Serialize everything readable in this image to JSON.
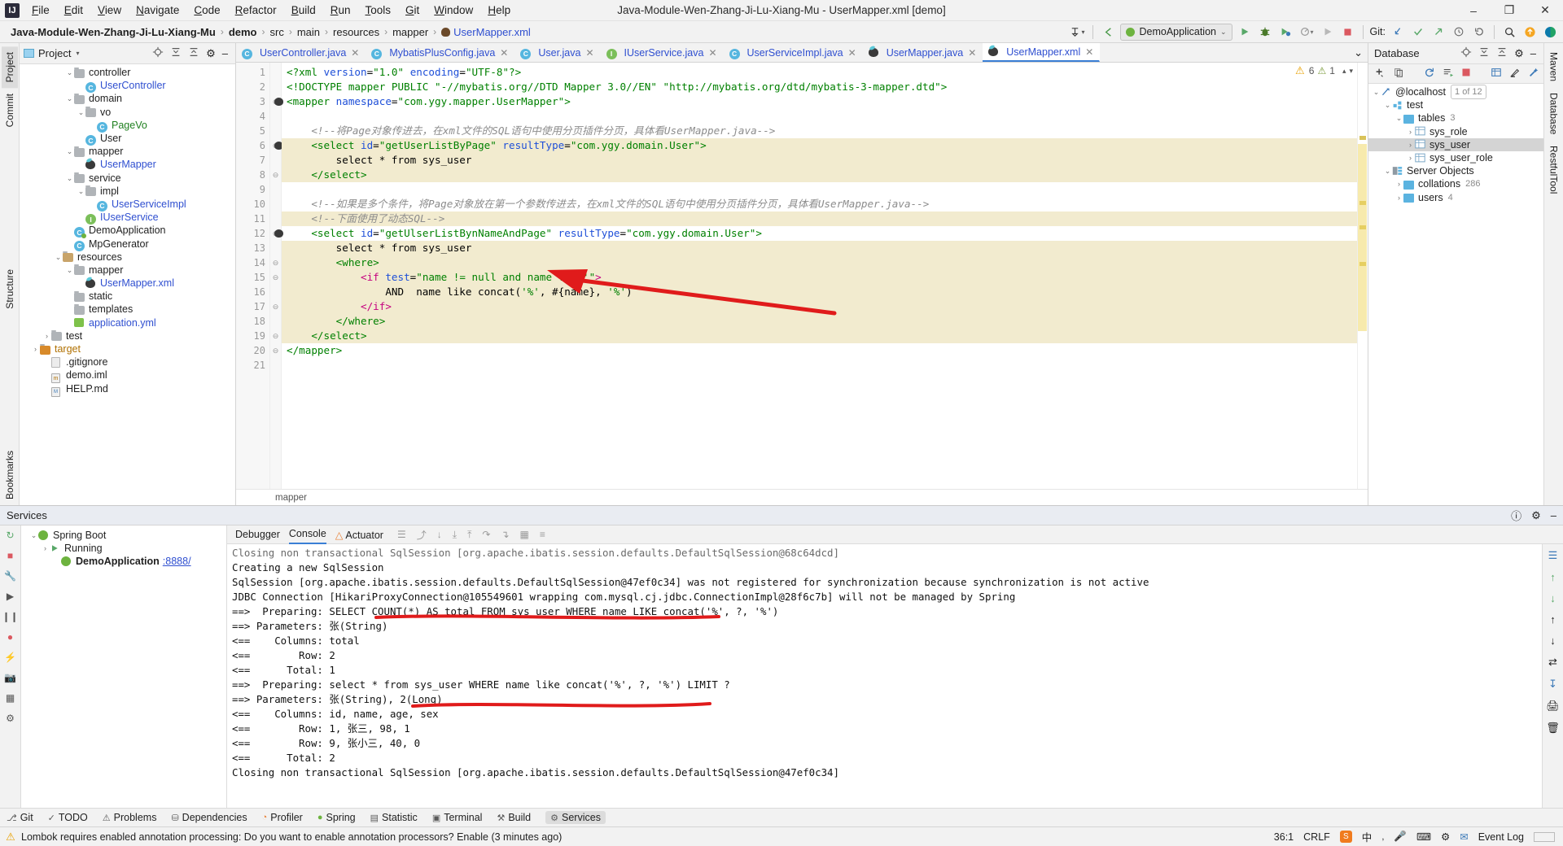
{
  "window": {
    "title": "Java-Module-Wen-Zhang-Ji-Lu-Xiang-Mu - UserMapper.xml [demo]",
    "minimize": "–",
    "maximize": "❐",
    "close": "✕"
  },
  "menu": [
    "File",
    "Edit",
    "View",
    "Navigate",
    "Code",
    "Refactor",
    "Build",
    "Run",
    "Tools",
    "Git",
    "Window",
    "Help"
  ],
  "breadcrumbs": [
    "Java-Module-Wen-Zhang-Ji-Lu-Xiang-Mu",
    "demo",
    "src",
    "main",
    "resources",
    "mapper",
    "UserMapper.xml"
  ],
  "toolbar": {
    "run_config": "DemoApplication",
    "chevron": "⌄",
    "git_label": "Git:",
    "run": "▶",
    "debug": "🐞",
    "coverage": "▶",
    "profile": "▶",
    "stop": "■",
    "search": "⌕",
    "update": "↺",
    "commit": "✓",
    "push": "↗",
    "history": "◴"
  },
  "left_stripe": [
    {
      "label": "Project",
      "selected": true
    },
    {
      "label": "Commit",
      "selected": false
    },
    {
      "label": "Structure",
      "selected": false
    },
    {
      "label": "Bookmarks",
      "selected": false
    }
  ],
  "right_stripe": [
    {
      "label": "Maven"
    },
    {
      "label": "Database"
    },
    {
      "label": "RestfulTool"
    }
  ],
  "project_panel": {
    "title": "Project",
    "tree": [
      {
        "indent": 4,
        "twist": "⌄",
        "icon": "folder",
        "label": "controller",
        "color": ""
      },
      {
        "indent": 5,
        "twist": "",
        "icon": "class",
        "label": "UserController",
        "color": "blue"
      },
      {
        "indent": 4,
        "twist": "⌄",
        "icon": "folder",
        "label": "domain",
        "color": ""
      },
      {
        "indent": 5,
        "twist": "⌄",
        "icon": "folder",
        "label": "vo",
        "color": ""
      },
      {
        "indent": 6,
        "twist": "",
        "icon": "class",
        "label": "PageVo",
        "color": "green"
      },
      {
        "indent": 5,
        "twist": "",
        "icon": "class",
        "label": "User",
        "color": ""
      },
      {
        "indent": 4,
        "twist": "⌄",
        "icon": "folder",
        "label": "mapper",
        "color": ""
      },
      {
        "indent": 5,
        "twist": "",
        "icon": "mybatis",
        "label": "UserMapper",
        "color": "blue"
      },
      {
        "indent": 4,
        "twist": "⌄",
        "icon": "folder",
        "label": "service",
        "color": ""
      },
      {
        "indent": 5,
        "twist": "⌄",
        "icon": "folder",
        "label": "impl",
        "color": ""
      },
      {
        "indent": 6,
        "twist": "",
        "icon": "class",
        "label": "UserServiceImpl",
        "color": "blue"
      },
      {
        "indent": 5,
        "twist": "",
        "icon": "iface",
        "label": "IUserService",
        "color": "blue"
      },
      {
        "indent": 4,
        "twist": "",
        "icon": "spring",
        "label": "DemoApplication",
        "color": ""
      },
      {
        "indent": 4,
        "twist": "",
        "icon": "class",
        "label": "MpGenerator",
        "color": ""
      },
      {
        "indent": 3,
        "twist": "⌄",
        "icon": "res",
        "label": "resources",
        "color": ""
      },
      {
        "indent": 4,
        "twist": "⌄",
        "icon": "folder",
        "label": "mapper",
        "color": ""
      },
      {
        "indent": 5,
        "twist": "",
        "icon": "mybatis",
        "label": "UserMapper.xml",
        "color": "blue"
      },
      {
        "indent": 4,
        "twist": "",
        "icon": "folder",
        "label": "static",
        "color": ""
      },
      {
        "indent": 4,
        "twist": "",
        "icon": "folder",
        "label": "templates",
        "color": ""
      },
      {
        "indent": 4,
        "twist": "",
        "icon": "yml",
        "label": "application.yml",
        "color": "blue"
      },
      {
        "indent": 2,
        "twist": "›",
        "icon": "folder",
        "label": "test",
        "color": ""
      },
      {
        "indent": 1,
        "twist": "›",
        "icon": "target",
        "label": "target",
        "color": "orange"
      },
      {
        "indent": 2,
        "twist": "",
        "icon": "file",
        "label": ".gitignore",
        "color": ""
      },
      {
        "indent": 2,
        "twist": "",
        "icon": "iml",
        "label": "demo.iml",
        "color": ""
      },
      {
        "indent": 2,
        "twist": "",
        "icon": "md",
        "label": "HELP.md",
        "color": ""
      }
    ]
  },
  "editor_tabs": [
    {
      "label": "UserController.java",
      "icon": "class",
      "active": false
    },
    {
      "label": "MybatisPlusConfig.java",
      "icon": "class",
      "active": false
    },
    {
      "label": "User.java",
      "icon": "class",
      "active": false
    },
    {
      "label": "IUserService.java",
      "icon": "iface",
      "active": false
    },
    {
      "label": "UserServiceImpl.java",
      "icon": "class",
      "active": false
    },
    {
      "label": "UserMapper.java",
      "icon": "mybatis",
      "active": false
    },
    {
      "label": "UserMapper.xml",
      "icon": "mybatis",
      "active": true
    }
  ],
  "editor": {
    "warning_count": "6",
    "weak_warning_count": "1",
    "breadcrumb_footer": "mapper",
    "lines": [
      {
        "n": "1",
        "fold": "",
        "mark": "",
        "hl": false,
        "tokens": [
          {
            "t": "<?xml ",
            "c": "tag"
          },
          {
            "t": "version",
            "c": "attr"
          },
          {
            "t": "=",
            "c": "plain"
          },
          {
            "t": "\"1.0\"",
            "c": "str"
          },
          {
            "t": " ",
            "c": "plain"
          },
          {
            "t": "encoding",
            "c": "attr"
          },
          {
            "t": "=",
            "c": "plain"
          },
          {
            "t": "\"UTF-8\"",
            "c": "str"
          },
          {
            "t": "?>",
            "c": "tag"
          }
        ]
      },
      {
        "n": "2",
        "fold": "",
        "mark": "",
        "hl": false,
        "tokens": [
          {
            "t": "<!DOCTYPE mapper PUBLIC ",
            "c": "doctype"
          },
          {
            "t": "\"-//mybatis.org//DTD Mapper 3.0//EN\"",
            "c": "str"
          },
          {
            "t": " ",
            "c": "plain"
          },
          {
            "t": "\"http://mybatis.org/dtd/mybatis-3-mapper.dtd\"",
            "c": "str"
          },
          {
            "t": ">",
            "c": "doctype"
          }
        ]
      },
      {
        "n": "3",
        "fold": "⊖",
        "mark": "mybatis",
        "hl": false,
        "tokens": [
          {
            "t": "<mapper ",
            "c": "tag"
          },
          {
            "t": "namespace",
            "c": "attr"
          },
          {
            "t": "=",
            "c": "plain"
          },
          {
            "t": "\"com.ygy.mapper.UserMapper\"",
            "c": "str"
          },
          {
            "t": ">",
            "c": "tag"
          }
        ]
      },
      {
        "n": "4",
        "fold": "",
        "mark": "",
        "hl": false,
        "tokens": []
      },
      {
        "n": "5",
        "fold": "",
        "mark": "",
        "hl": false,
        "tokens": [
          {
            "t": "    <!--将Page对象传进去，在xml文件的SQL语句中使用分页插件分页，具体看UserMapper.java-->",
            "c": "cmt"
          }
        ]
      },
      {
        "n": "6",
        "fold": "⊖",
        "mark": "mybatis",
        "hl": true,
        "tokens": [
          {
            "t": "    <select ",
            "c": "tag"
          },
          {
            "t": "id",
            "c": "attr"
          },
          {
            "t": "=",
            "c": "plain"
          },
          {
            "t": "\"getUserListByPage\"",
            "c": "str"
          },
          {
            "t": " ",
            "c": "plain"
          },
          {
            "t": "resultType",
            "c": "attr"
          },
          {
            "t": "=",
            "c": "plain"
          },
          {
            "t": "\"com.ygy.domain.User\"",
            "c": "str"
          },
          {
            "t": ">",
            "c": "tag"
          }
        ]
      },
      {
        "n": "7",
        "fold": "",
        "mark": "",
        "hl": true,
        "tokens": [
          {
            "t": "        select * from sys_user",
            "c": "plain"
          }
        ]
      },
      {
        "n": "8",
        "fold": "⊖",
        "mark": "",
        "hl": true,
        "tokens": [
          {
            "t": "    </select>",
            "c": "tag"
          }
        ]
      },
      {
        "n": "9",
        "fold": "",
        "mark": "",
        "hl": false,
        "tokens": []
      },
      {
        "n": "10",
        "fold": "",
        "mark": "",
        "hl": false,
        "tokens": [
          {
            "t": "    <!--如果是多个条件，将Page对象放在第一个参数传进去，在xml文件的SQL语句中使用分页插件分页，具体看UserMapper.java-->",
            "c": "cmt"
          }
        ]
      },
      {
        "n": "11",
        "fold": "",
        "mark": "",
        "hl": true,
        "tokens": [
          {
            "t": "    <!--下面使用了动态SQL-->",
            "c": "cmt"
          }
        ]
      },
      {
        "n": "12",
        "fold": "⊖",
        "mark": "mybatis",
        "hl": false,
        "tokens": [
          {
            "t": "    <select ",
            "c": "tag"
          },
          {
            "t": "id",
            "c": "attr"
          },
          {
            "t": "=",
            "c": "plain"
          },
          {
            "t": "\"getUlserListBynNameAndPage\"",
            "c": "str"
          },
          {
            "t": " ",
            "c": "plain"
          },
          {
            "t": "resultType",
            "c": "attr"
          },
          {
            "t": "=",
            "c": "plain"
          },
          {
            "t": "\"com.ygy.domain.User\"",
            "c": "str"
          },
          {
            "t": ">",
            "c": "tag"
          }
        ]
      },
      {
        "n": "13",
        "fold": "",
        "mark": "",
        "hl": true,
        "tokens": [
          {
            "t": "        select * from sys_user",
            "c": "plain"
          }
        ]
      },
      {
        "n": "14",
        "fold": "⊖",
        "mark": "",
        "hl": true,
        "tokens": [
          {
            "t": "        <where>",
            "c": "tag"
          }
        ]
      },
      {
        "n": "15",
        "fold": "⊖",
        "mark": "",
        "hl": true,
        "tokens": [
          {
            "t": "            <if ",
            "c": "pink"
          },
          {
            "t": "test",
            "c": "attr"
          },
          {
            "t": "=",
            "c": "plain"
          },
          {
            "t": "\"name != null and name != ''\"",
            "c": "str"
          },
          {
            "t": ">",
            "c": "pink"
          }
        ]
      },
      {
        "n": "16",
        "fold": "",
        "mark": "",
        "hl": true,
        "tokens": [
          {
            "t": "                AND  name like concat(",
            "c": "plain"
          },
          {
            "t": "'%'",
            "c": "str"
          },
          {
            "t": ", #{name}, ",
            "c": "plain"
          },
          {
            "t": "'%'",
            "c": "str"
          },
          {
            "t": ")",
            "c": "plain"
          }
        ]
      },
      {
        "n": "17",
        "fold": "⊖",
        "mark": "",
        "hl": true,
        "tokens": [
          {
            "t": "            </if>",
            "c": "pink"
          }
        ]
      },
      {
        "n": "18",
        "fold": "",
        "mark": "",
        "hl": true,
        "tokens": [
          {
            "t": "        </where>",
            "c": "tag"
          }
        ]
      },
      {
        "n": "19",
        "fold": "⊖",
        "mark": "",
        "hl": true,
        "tokens": [
          {
            "t": "    </select>",
            "c": "tag"
          }
        ]
      },
      {
        "n": "20",
        "fold": "⊖",
        "mark": "",
        "hl": false,
        "tokens": [
          {
            "t": "</mapper>",
            "c": "tag"
          }
        ]
      },
      {
        "n": "21",
        "fold": "",
        "mark": "",
        "hl": false,
        "tokens": []
      }
    ]
  },
  "database_panel": {
    "title": "Database",
    "tree": [
      {
        "indent": 0,
        "twist": "⌄",
        "icon": "conn",
        "label": "@localhost",
        "badge": "1 of 12",
        "selected": false
      },
      {
        "indent": 1,
        "twist": "⌄",
        "icon": "schema",
        "label": "test",
        "badge": "",
        "selected": false
      },
      {
        "indent": 2,
        "twist": "⌄",
        "icon": "folder",
        "label": "tables",
        "badge": "3",
        "selected": false
      },
      {
        "indent": 3,
        "twist": "›",
        "icon": "table",
        "label": "sys_role",
        "badge": "",
        "selected": false
      },
      {
        "indent": 3,
        "twist": "›",
        "icon": "table",
        "label": "sys_user",
        "badge": "",
        "selected": true
      },
      {
        "indent": 3,
        "twist": "›",
        "icon": "table",
        "label": "sys_user_role",
        "badge": "",
        "selected": false
      },
      {
        "indent": 1,
        "twist": "⌄",
        "icon": "server",
        "label": "Server Objects",
        "badge": "",
        "selected": false
      },
      {
        "indent": 2,
        "twist": "›",
        "icon": "folder",
        "label": "collations",
        "badge": "286",
        "selected": false
      },
      {
        "indent": 2,
        "twist": "›",
        "icon": "folder",
        "label": "users",
        "badge": "4",
        "selected": false
      }
    ]
  },
  "services": {
    "title": "Services",
    "tree": [
      {
        "indent": 0,
        "twist": "⌄",
        "icon": "spring",
        "label": "Spring Boot",
        "color": "",
        "bold": false
      },
      {
        "indent": 1,
        "twist": "›",
        "icon": "run",
        "label": "Running",
        "color": "",
        "bold": false
      },
      {
        "indent": 2,
        "twist": "",
        "icon": "spring",
        "label": "DemoApplication",
        "link": ":8888/",
        "color": "",
        "bold": true
      }
    ],
    "tabs": [
      "Debugger",
      "Console",
      "Actuator"
    ],
    "active_tab": "Console",
    "console_lines": [
      "Closing non transactional SqlSession [org.apache.ibatis.session.defaults.DefaultSqlSession@68c64dcd]",
      "Creating a new SqlSession",
      "SqlSession [org.apache.ibatis.session.defaults.DefaultSqlSession@47ef0c34] was not registered for synchronization because synchronization is not active",
      "JDBC Connection [HikariProxyConnection@105549601 wrapping com.mysql.cj.jdbc.ConnectionImpl@28f6c7b] will not be managed by Spring",
      "==>  Preparing: SELECT COUNT(*) AS total FROM sys_user WHERE name LIKE concat('%', ?, '%')",
      "==> Parameters: 张(String)",
      "<==    Columns: total",
      "<==        Row: 2",
      "<==      Total: 1",
      "==>  Preparing: select * from sys_user WHERE name like concat('%', ?, '%') LIMIT ?",
      "==> Parameters: 张(String), 2(Long)",
      "<==    Columns: id, name, age, sex",
      "<==        Row: 1, 张三, 98, 1",
      "<==        Row: 9, 张小三, 40, 0",
      "<==      Total: 2",
      "Closing non transactional SqlSession [org.apache.ibatis.session.defaults.DefaultSqlSession@47ef0c34]",
      ""
    ]
  },
  "bottom_bar": [
    {
      "label": "Git",
      "icon": "git",
      "active": false
    },
    {
      "label": "TODO",
      "icon": "todo",
      "active": false
    },
    {
      "label": "Problems",
      "icon": "problems",
      "active": false
    },
    {
      "label": "Dependencies",
      "icon": "deps",
      "active": false
    },
    {
      "label": "Profiler",
      "icon": "profiler",
      "active": false
    },
    {
      "label": "Spring",
      "icon": "spring",
      "active": false
    },
    {
      "label": "Statistic",
      "icon": "statistic",
      "active": false
    },
    {
      "label": "Terminal",
      "icon": "terminal",
      "active": false
    },
    {
      "label": "Build",
      "icon": "build",
      "active": false
    },
    {
      "label": "Services",
      "icon": "services",
      "active": true
    }
  ],
  "status_bar": {
    "message": "Lombok requires enabled annotation processing: Do you want to enable annotation processors? Enable (3 minutes ago)",
    "caret": "36:1",
    "line_separator": "CRLF",
    "event_log": "Event Log"
  }
}
